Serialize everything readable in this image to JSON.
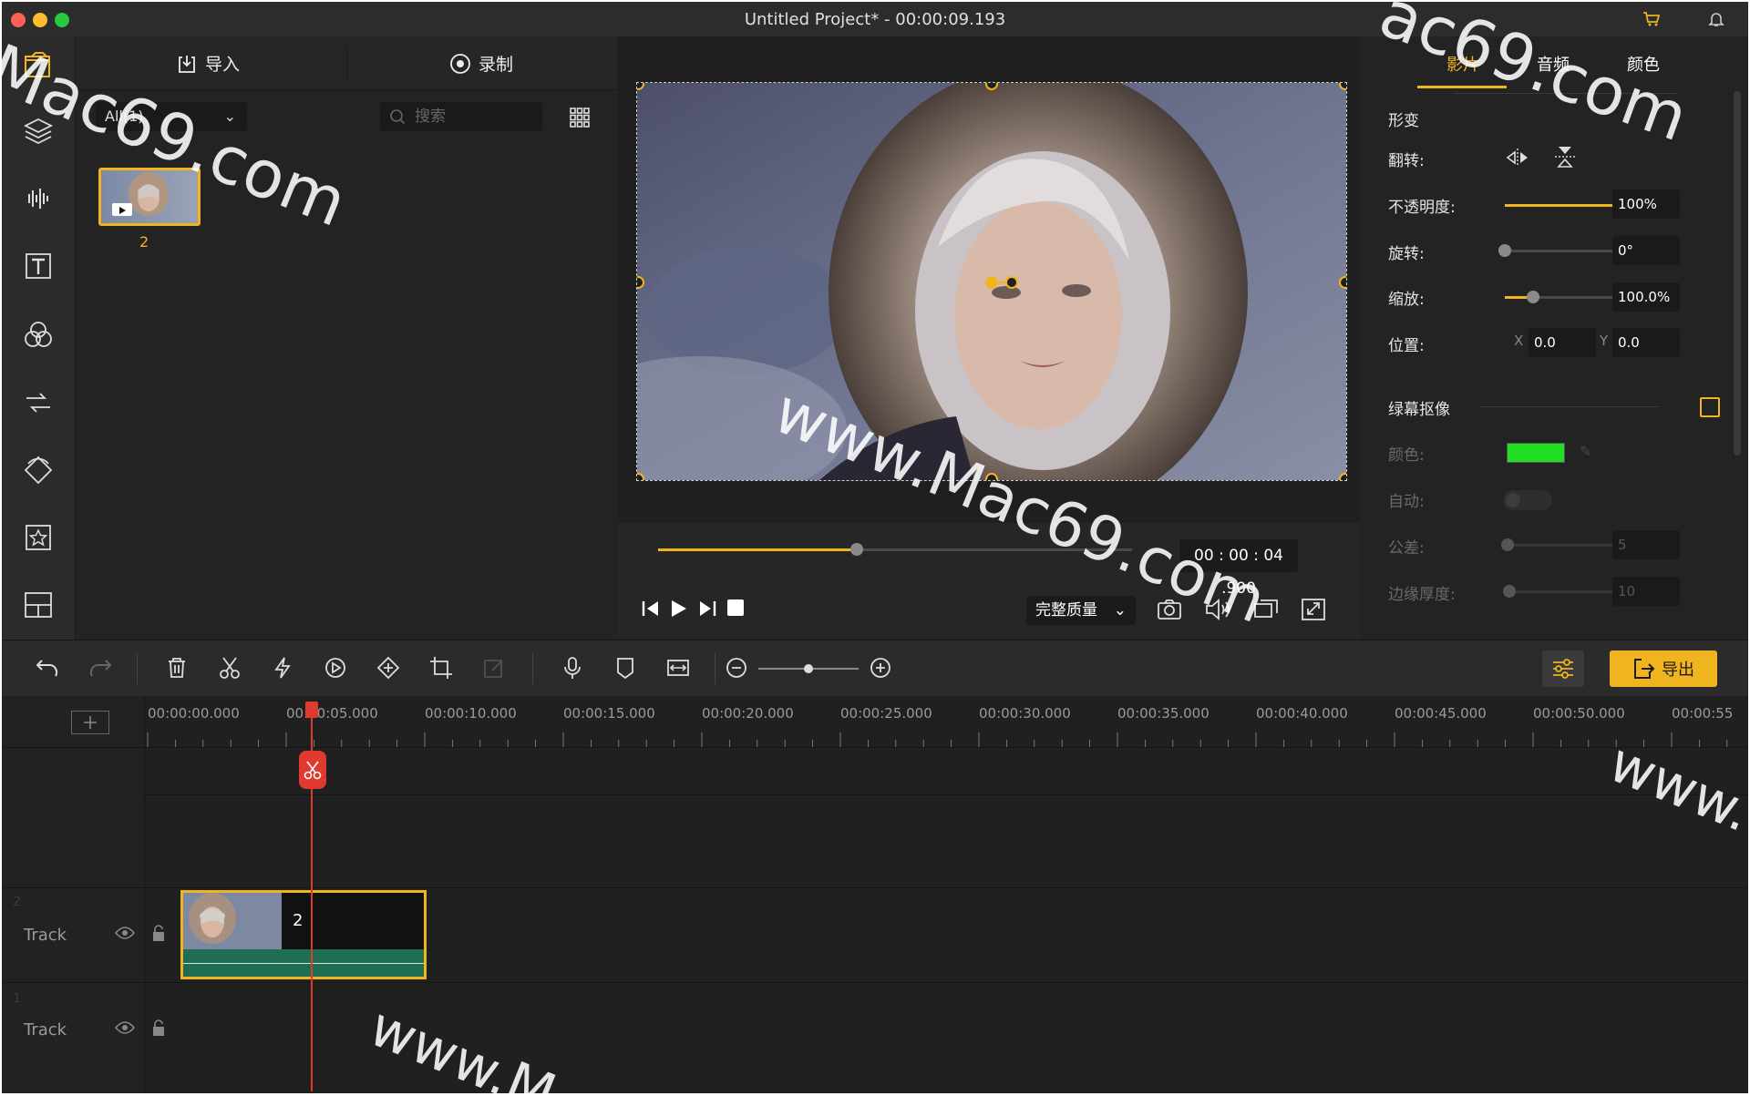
{
  "window": {
    "title": "Untitled Project* - 00:00:09.193"
  },
  "media_panel": {
    "tabs": [
      {
        "label": "导入"
      },
      {
        "label": "录制"
      }
    ],
    "filter": "All(1)",
    "search_placeholder": "搜索",
    "items": [
      {
        "label": "2"
      }
    ]
  },
  "preview": {
    "current_time": "00 : 00 : 04 .900",
    "progress_fraction": 0.42,
    "quality": "完整质量"
  },
  "properties": {
    "tabs": [
      {
        "label": "影片"
      },
      {
        "label": "音频"
      },
      {
        "label": "颜色"
      }
    ],
    "active_tab": "影片",
    "section_transform": "形变",
    "flip_label": "翻转:",
    "opacity": {
      "label": "不透明度:",
      "value": "100%",
      "fraction": 1.0
    },
    "rotation": {
      "label": "旋转:",
      "value": "0°",
      "fraction": 0.0
    },
    "scale": {
      "label": "缩放:",
      "value": "100.0%",
      "fraction": 0.24
    },
    "position": {
      "label": "位置:",
      "x_label": "X",
      "x": "0.0",
      "y_label": "Y",
      "y": "0.0"
    },
    "chroma": {
      "label": "绿幕抠像",
      "color_label": "颜色:",
      "color": "#22dd22",
      "auto_label": "自动:",
      "tolerance": {
        "label": "公差:",
        "value": "5",
        "fraction": 0.02
      },
      "edge": {
        "label": "边缘厚度:",
        "value": "10",
        "fraction": 0.04
      }
    }
  },
  "toolbar": {
    "export_label": "导出",
    "zoom_fraction": 0.5
  },
  "timeline": {
    "ticks": [
      "00:00:00.000",
      "00:00:05.000",
      "00:00:10.000",
      "00:00:15.000",
      "00:00:20.000",
      "00:00:25.000",
      "00:00:30.000",
      "00:00:35.000",
      "00:00:40.000",
      "00:00:45.000",
      "00:00:50.000",
      "00:00:55"
    ],
    "tracks": [
      {
        "number": "2",
        "name": "Track"
      },
      {
        "number": "1",
        "name": "Track"
      }
    ],
    "clip_label": "2"
  },
  "watermarks": [
    "Mac69.com",
    "ac69.com",
    "www.Mac69.com",
    "www.",
    "www.M"
  ],
  "colors": {
    "accent": "#f0b41e",
    "playhead": "#e03a2f",
    "audio_track": "#1f6e54"
  }
}
